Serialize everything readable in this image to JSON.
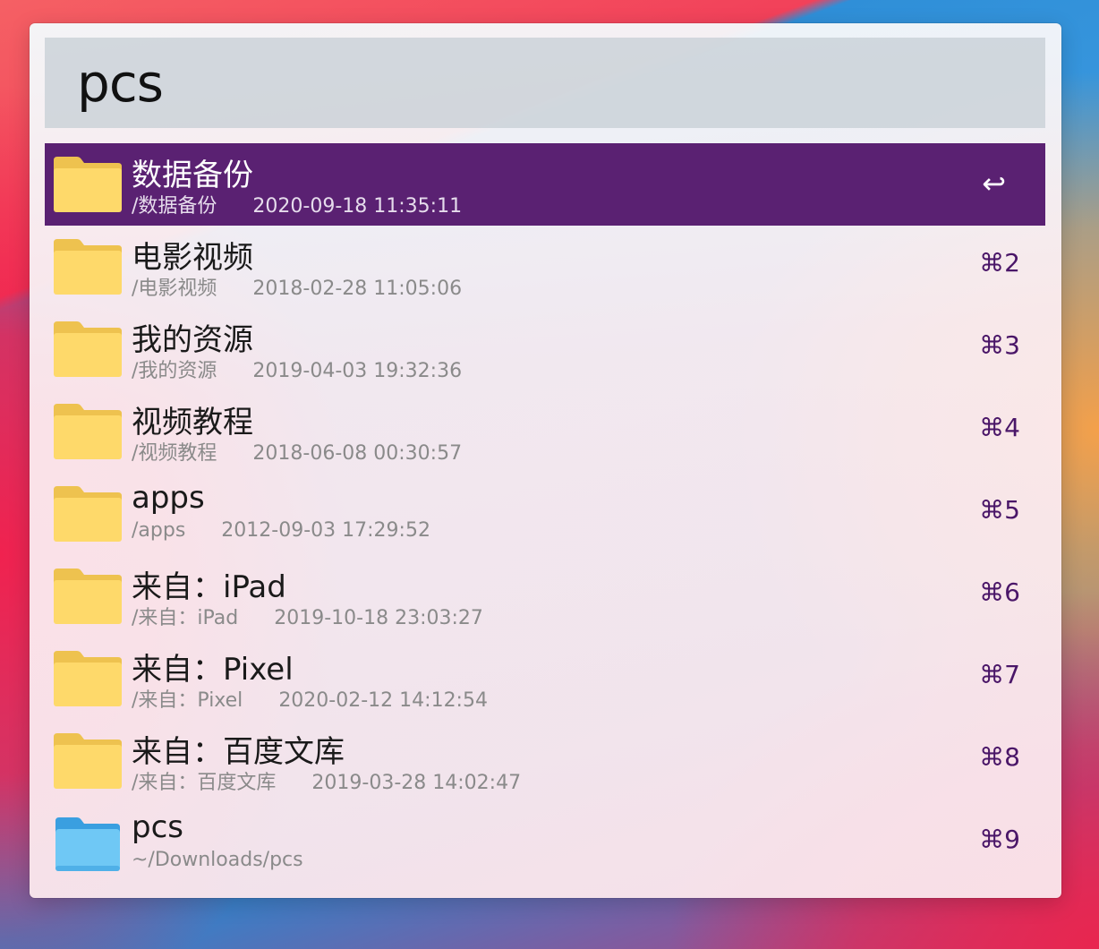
{
  "search": {
    "query": "pcs"
  },
  "results": [
    {
      "title": "数据备份",
      "path": "/数据备份",
      "date": "2020-09-18 11:35:11",
      "shortcut": "↩",
      "icon": "folder-yellow-icon",
      "selected": true
    },
    {
      "title": "电影视频",
      "path": "/电影视频",
      "date": "2018-02-28 11:05:06",
      "shortcut": "⌘2",
      "icon": "folder-yellow-icon"
    },
    {
      "title": "我的资源",
      "path": "/我的资源",
      "date": "2019-04-03 19:32:36",
      "shortcut": "⌘3",
      "icon": "folder-yellow-icon"
    },
    {
      "title": "视频教程",
      "path": "/视频教程",
      "date": "2018-06-08 00:30:57",
      "shortcut": "⌘4",
      "icon": "folder-yellow-icon"
    },
    {
      "title": "apps",
      "path": "/apps",
      "date": "2012-09-03 17:29:52",
      "shortcut": "⌘5",
      "icon": "folder-yellow-icon"
    },
    {
      "title": "来自：iPad",
      "path": "/来自：iPad",
      "date": "2019-10-18 23:03:27",
      "shortcut": "⌘6",
      "icon": "folder-yellow-icon"
    },
    {
      "title": "来自：Pixel",
      "path": "/来自：Pixel",
      "date": "2020-02-12 14:12:54",
      "shortcut": "⌘7",
      "icon": "folder-yellow-icon"
    },
    {
      "title": "来自：百度文库",
      "path": "/来自：百度文库",
      "date": "2019-03-28 14:02:47",
      "shortcut": "⌘8",
      "icon": "folder-yellow-icon"
    },
    {
      "title": "pcs",
      "path": "~/Downloads/pcs",
      "date": "",
      "shortcut": "⌘9",
      "icon": "folder-blue-icon"
    }
  ],
  "colors": {
    "selection": "#5a2172",
    "shortcut": "#4a1668",
    "folder_yellow": "#fed96a",
    "folder_blue": "#6fc8f5"
  }
}
